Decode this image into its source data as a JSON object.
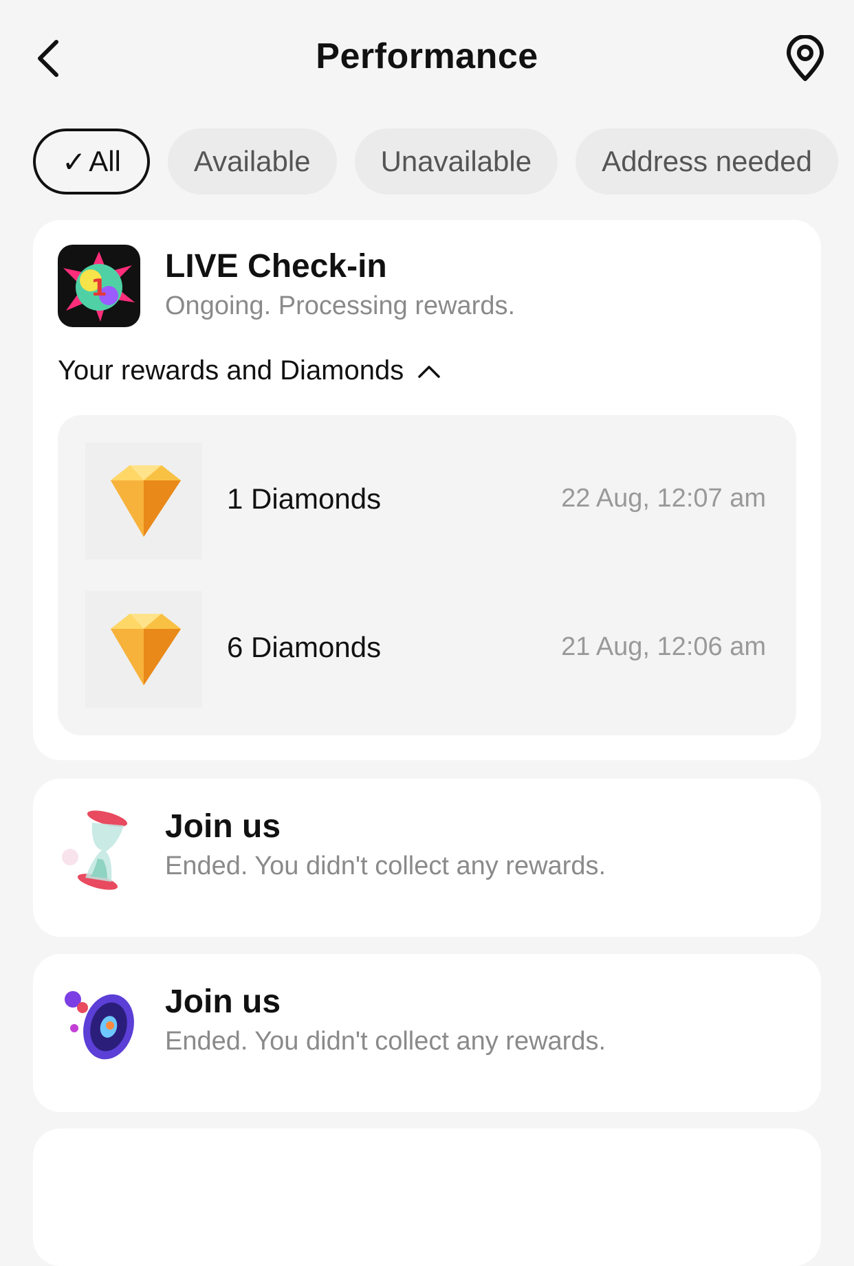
{
  "header": {
    "title": "Performance",
    "back_icon": "chevron-left-icon",
    "location_icon": "location-pin-icon"
  },
  "filters": [
    {
      "label": "All",
      "active": true
    },
    {
      "label": "Available",
      "active": false
    },
    {
      "label": "Unavailable",
      "active": false
    },
    {
      "label": "Address needed",
      "active": false
    }
  ],
  "events": [
    {
      "title": "LIVE Check-in",
      "status": "Ongoing. Processing rewards.",
      "rewards_toggle": "Your rewards and Diamonds",
      "rewards": [
        {
          "name": "1 Diamonds",
          "time": "22 Aug, 12:07 am"
        },
        {
          "name": "6 Diamonds",
          "time": "21 Aug, 12:06 am"
        }
      ]
    },
    {
      "title": "Join us",
      "status": "Ended. You didn't collect any rewards."
    },
    {
      "title": "Join us",
      "status": "Ended. You didn't collect any rewards."
    }
  ],
  "colors": {
    "background": "#f5f5f5",
    "card": "#ffffff",
    "chip": "#ebebeb",
    "muted_text": "#8a8a8a",
    "diamond": "#f5a623"
  }
}
